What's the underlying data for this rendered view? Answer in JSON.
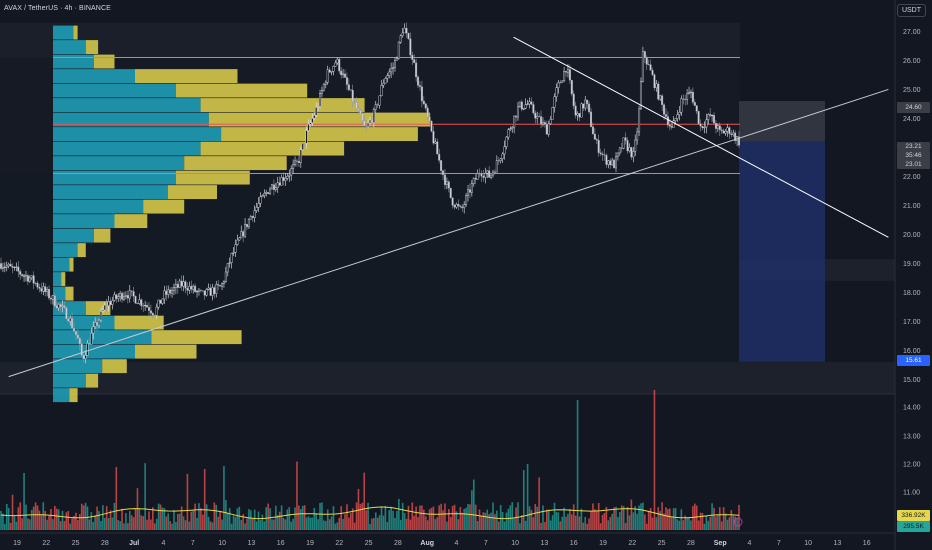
{
  "header": {
    "symbol": "AVAX / TetherUS · 4h · BINANCE",
    "currency": "USDT"
  },
  "price_tags": {
    "upper": "24.60",
    "last": "23.21",
    "countdown": "35:46",
    "open": "23.01",
    "target": "15.61",
    "vol_ma": "336.92K",
    "volume": "295.5K"
  },
  "colors": {
    "background": "#131722",
    "up": "#26a69a",
    "down": "#ef5350",
    "profile_cyan": "#1ea5bd",
    "profile_yellow": "#d4c84a",
    "range_line": "#26c6da",
    "poc_line": "#ef5350",
    "short_target_zone": "#1e2f66",
    "trend_line": "#c8cbd4",
    "vol_ma_line": "#e6d84a"
  },
  "chart_data": {
    "type": "candlestick",
    "symbol": "AVAX/USDT",
    "timeframe": "4h",
    "exchange": "BINANCE",
    "price_axis": {
      "ticks": [
        15,
        16,
        17,
        18,
        19,
        20,
        21,
        22,
        23,
        24,
        25,
        26,
        27
      ],
      "range": [
        14.5,
        27.6
      ]
    },
    "volume_axis": {
      "ticks": [
        "14.00",
        "13.00",
        "12.00",
        "11.00"
      ]
    },
    "time_axis": [
      "19",
      "22",
      "25",
      "28",
      "Jul",
      "4",
      "7",
      "10",
      "13",
      "16",
      "19",
      "22",
      "25",
      "28",
      "Aug",
      "4",
      "7",
      "10",
      "13",
      "16",
      "19",
      "22",
      "25",
      "28",
      "Sep",
      "4",
      "7",
      "10",
      "13",
      "16"
    ],
    "price_path": [
      [
        0,
        19.0
      ],
      [
        3,
        18.5
      ],
      [
        5,
        17.9
      ],
      [
        7,
        17.2
      ],
      [
        8,
        16.4
      ],
      [
        8.5,
        15.7
      ],
      [
        9.5,
        16.6
      ],
      [
        11,
        17.6
      ],
      [
        13,
        18.0
      ],
      [
        15,
        17.6
      ],
      [
        16,
        17.3
      ],
      [
        17,
        17.9
      ],
      [
        19,
        18.3
      ],
      [
        21,
        17.9
      ],
      [
        23,
        18.2
      ],
      [
        24,
        19.2
      ],
      [
        26,
        20.6
      ],
      [
        28,
        21.6
      ],
      [
        30,
        22.1
      ],
      [
        31,
        22.5
      ],
      [
        32,
        23.6
      ],
      [
        33,
        24.4
      ],
      [
        34,
        25.5
      ],
      [
        35,
        26.0
      ],
      [
        36,
        25.2
      ],
      [
        37,
        24.4
      ],
      [
        38,
        23.6
      ],
      [
        39,
        24.2
      ],
      [
        40,
        25.4
      ],
      [
        41,
        25.8
      ],
      [
        42,
        27.2
      ],
      [
        43,
        26.0
      ],
      [
        44,
        24.6
      ],
      [
        45,
        23.4
      ],
      [
        46,
        22.2
      ],
      [
        47,
        21.2
      ],
      [
        48,
        20.8
      ],
      [
        49,
        21.6
      ],
      [
        50,
        22.2
      ],
      [
        51,
        22.0
      ],
      [
        52,
        22.6
      ],
      [
        53,
        23.6
      ],
      [
        54,
        24.4
      ],
      [
        55,
        24.5
      ],
      [
        56,
        24.0
      ],
      [
        57,
        23.6
      ],
      [
        58,
        25.0
      ],
      [
        59,
        25.8
      ],
      [
        60,
        24.0
      ],
      [
        61,
        24.6
      ],
      [
        62,
        23.2
      ],
      [
        63,
        22.6
      ],
      [
        64,
        22.4
      ],
      [
        65,
        23.2
      ],
      [
        66,
        22.7
      ],
      [
        66.5,
        23.9
      ],
      [
        67,
        26.3
      ],
      [
        68,
        25.4
      ],
      [
        69,
        24.4
      ],
      [
        70,
        23.6
      ],
      [
        71,
        24.6
      ],
      [
        72,
        24.9
      ],
      [
        73,
        23.7
      ],
      [
        74,
        24.1
      ],
      [
        75,
        23.5
      ],
      [
        76,
        23.6
      ],
      [
        77,
        23.2
      ]
    ],
    "horizontal_levels": [
      {
        "price": 26.1,
        "label": "range high"
      },
      {
        "price": 23.8,
        "label": "point of control"
      },
      {
        "price": 22.1,
        "label": "range low"
      }
    ],
    "trend_lines": [
      {
        "from": [
          1,
          15.1
        ],
        "to": [
          116,
          25.0
        ]
      },
      {
        "from": [
          67,
          26.8
        ],
        "to": [
          116,
          19.9
        ]
      }
    ],
    "short_position": {
      "entry": 23.2,
      "stop": 24.6,
      "target": 15.61
    },
    "volume_profile": {
      "bins_top_price": 27.2,
      "bin_step": 0.5,
      "cyan": [
        0.5,
        0.8,
        1,
        2,
        3,
        3.6,
        3.8,
        4.1,
        3.6,
        3.2,
        3,
        2.8,
        2.2,
        1.5,
        1,
        0.6,
        0.4,
        0.2,
        0.3,
        0.8,
        1.5,
        2.4,
        2,
        1.2,
        0.8,
        0.4
      ],
      "yellow": [
        0.1,
        0.3,
        0.5,
        2.5,
        3.2,
        4.0,
        5.4,
        4.8,
        3.5,
        2.5,
        1.8,
        1.2,
        1.0,
        0.8,
        0.4,
        0.2,
        0.1,
        0.1,
        0.2,
        0.6,
        1.2,
        2.2,
        1.5,
        0.6,
        0.3,
        0.2
      ]
    },
    "volume": {
      "ma_label": "336.92K",
      "last_label": "295.5K"
    }
  }
}
